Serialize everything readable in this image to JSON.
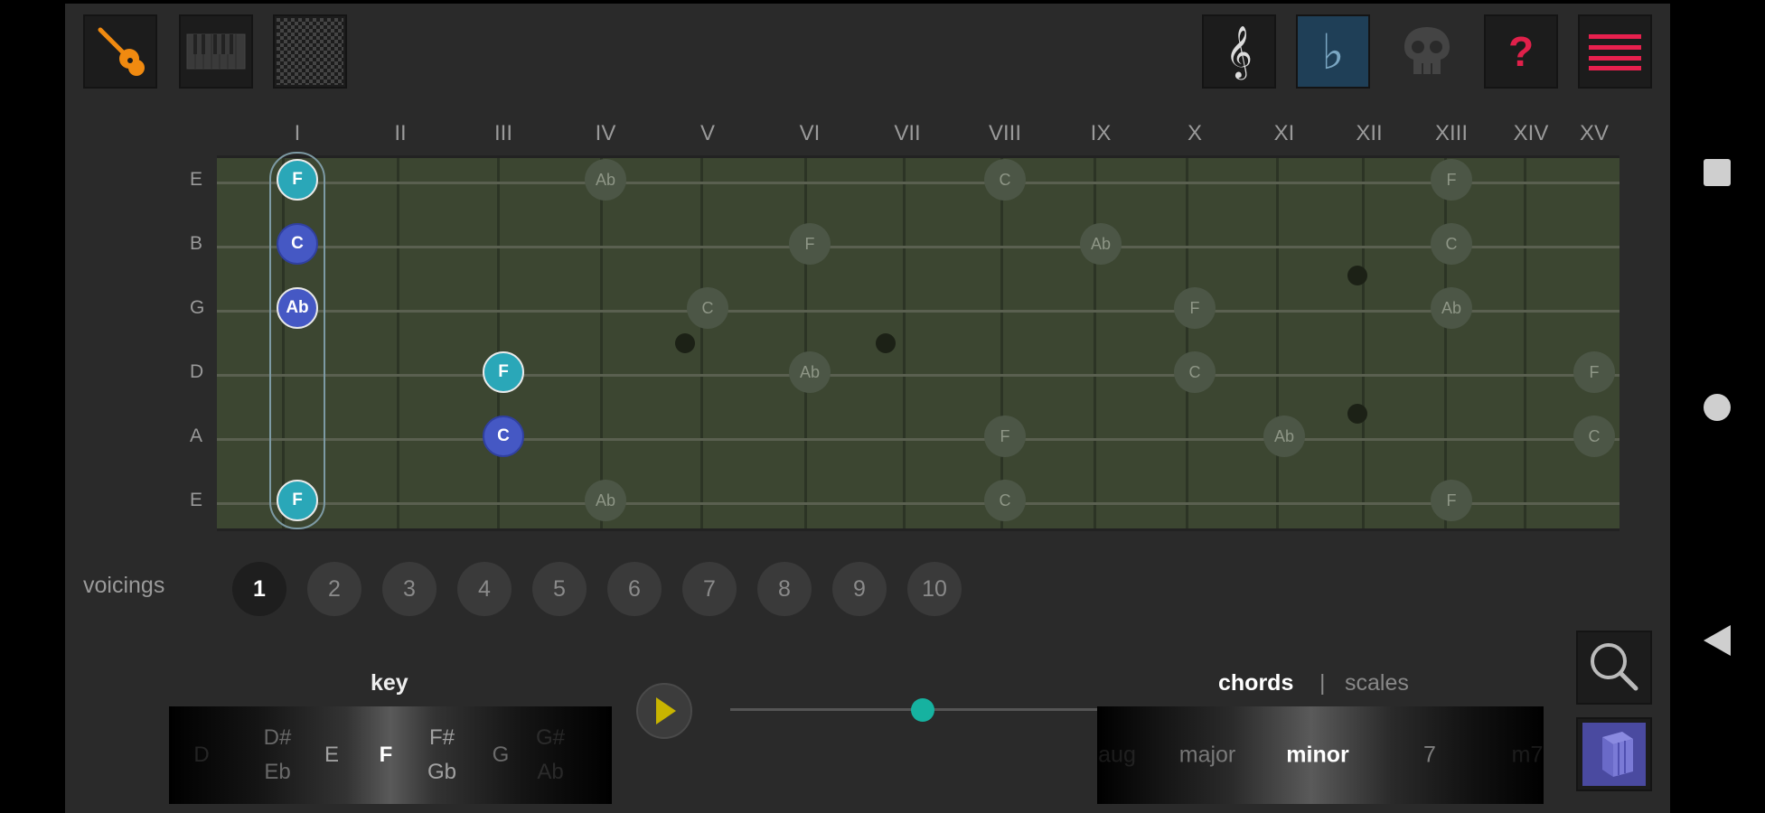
{
  "toolbar": {
    "left": [
      {
        "name": "guitar-icon",
        "color": "#f08a10"
      },
      {
        "name": "piano-icon"
      },
      {
        "name": "grid-icon"
      }
    ],
    "right": [
      {
        "name": "treble-clef-icon",
        "glyph": "𝄞"
      },
      {
        "name": "flat-icon",
        "glyph": "♭",
        "active": true
      },
      {
        "name": "skull-icon"
      },
      {
        "name": "help-icon",
        "glyph": "?",
        "color": "#e0204a"
      },
      {
        "name": "menu-icon",
        "color": "#e8204e"
      }
    ]
  },
  "fretboard": {
    "fret_numbers": [
      "I",
      "II",
      "III",
      "IV",
      "V",
      "VI",
      "VII",
      "VIII",
      "IX",
      "X",
      "XI",
      "XII",
      "XIII",
      "XIV",
      "XV"
    ],
    "strings": [
      "E",
      "B",
      "G",
      "D",
      "A",
      "E"
    ],
    "chord_notes": [
      {
        "string": 1,
        "fret": 1,
        "label": "F",
        "role": "root"
      },
      {
        "string": 2,
        "fret": 1,
        "label": "C",
        "role": "fifth"
      },
      {
        "string": 3,
        "fret": 1,
        "label": "Ab",
        "role": "third"
      },
      {
        "string": 4,
        "fret": 3,
        "label": "F",
        "role": "root"
      },
      {
        "string": 5,
        "fret": 3,
        "label": "C",
        "role": "fifth"
      },
      {
        "string": 6,
        "fret": 1,
        "label": "F",
        "role": "root"
      }
    ],
    "other_notes": [
      {
        "string": 1,
        "fret": 4,
        "label": "Ab"
      },
      {
        "string": 1,
        "fret": 8,
        "label": "C"
      },
      {
        "string": 1,
        "fret": 13,
        "label": "F"
      },
      {
        "string": 2,
        "fret": 6,
        "label": "F"
      },
      {
        "string": 2,
        "fret": 9,
        "label": "Ab"
      },
      {
        "string": 2,
        "fret": 13,
        "label": "C"
      },
      {
        "string": 3,
        "fret": 5,
        "label": "C"
      },
      {
        "string": 3,
        "fret": 10,
        "label": "F"
      },
      {
        "string": 3,
        "fret": 13,
        "label": "Ab"
      },
      {
        "string": 4,
        "fret": 6,
        "label": "Ab"
      },
      {
        "string": 4,
        "fret": 10,
        "label": "C"
      },
      {
        "string": 4,
        "fret": 15,
        "label": "F"
      },
      {
        "string": 5,
        "fret": 8,
        "label": "F"
      },
      {
        "string": 5,
        "fret": 11,
        "label": "Ab"
      },
      {
        "string": 5,
        "fret": 15,
        "label": "C"
      },
      {
        "string": 6,
        "fret": 4,
        "label": "Ab"
      },
      {
        "string": 6,
        "fret": 8,
        "label": "C"
      },
      {
        "string": 6,
        "fret": 13,
        "label": "F"
      }
    ]
  },
  "voicings": {
    "label": "voicings",
    "items": [
      "1",
      "2",
      "3",
      "4",
      "5",
      "6",
      "7",
      "8",
      "9",
      "10"
    ],
    "selected": "1"
  },
  "key": {
    "title": "key",
    "items": [
      {
        "top": "D",
        "bottom": ""
      },
      {
        "top": "D#",
        "bottom": "Eb"
      },
      {
        "top": "E",
        "bottom": ""
      },
      {
        "top": "F",
        "bottom": "",
        "selected": true
      },
      {
        "top": "F#",
        "bottom": "Gb"
      },
      {
        "top": "G",
        "bottom": ""
      },
      {
        "top": "G#",
        "bottom": "Ab"
      }
    ]
  },
  "player": {
    "tempo_fraction": 0.49,
    "accent": "#16b2a0"
  },
  "chords": {
    "tabs": [
      "chords",
      "scales"
    ],
    "separator": "|",
    "active_tab": "chords",
    "items": [
      "aug",
      "major",
      "minor",
      "7",
      "m7"
    ],
    "selected": "minor"
  }
}
